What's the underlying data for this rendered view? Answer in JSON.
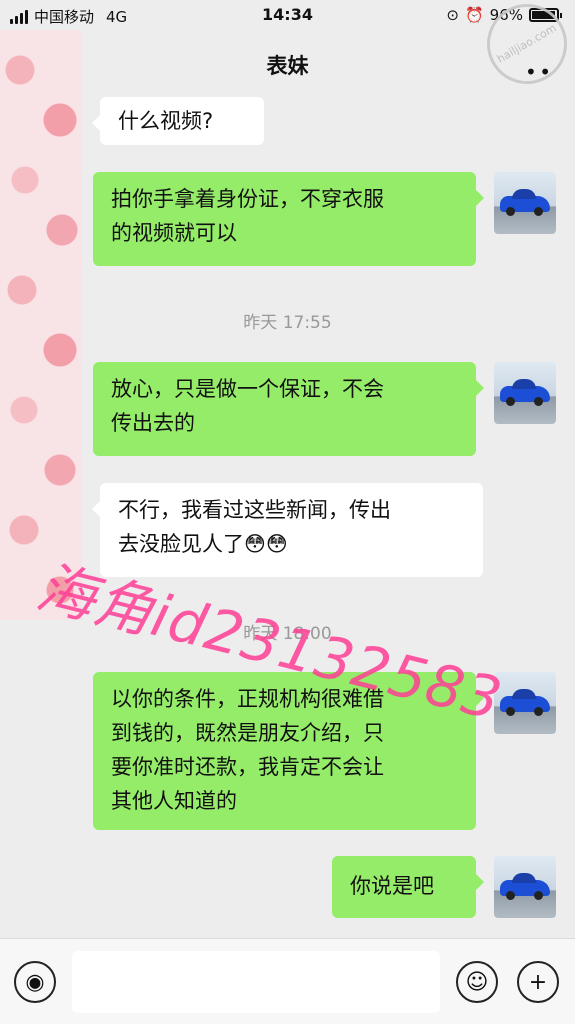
{
  "status_bar": {
    "carrier": "中国移动",
    "network": "4G",
    "time": "14:34",
    "battery": "96%",
    "battery_level": 0.96
  },
  "nav": {
    "title": "表妹",
    "more_icon": "more-dots-icon"
  },
  "stamp_text": "hailjiao.com",
  "messages": [
    {
      "side": "in",
      "text": "什么视频?"
    },
    {
      "side": "out",
      "lines": [
        "拍你手拿着身份证，不穿衣服",
        "的视频就可以"
      ]
    },
    {
      "type": "time",
      "text": "昨天 17:55"
    },
    {
      "side": "out",
      "lines": [
        "放心，只是做一个保证，不会",
        "传出去的"
      ]
    },
    {
      "side": "in",
      "lines": [
        "不行，我看过这些新闻，传出",
        "去没脸见人了😳😳"
      ]
    },
    {
      "type": "time",
      "text": "昨天 18:00"
    },
    {
      "side": "out",
      "lines": [
        "以你的条件，正规机构很难借",
        "到钱的，既然是朋友介绍，只",
        "要你准时还款，我肯定不会让",
        "其他人知道的"
      ]
    },
    {
      "side": "out",
      "text": "你说是吧"
    }
  ],
  "watermark": "海角id23132583",
  "input_bar": {
    "voice_icon": "voice-icon",
    "emoji_icon": "emoji-icon",
    "plus_icon": "plus-icon",
    "value": ""
  },
  "colors": {
    "outgoing_bubble": "#95ec69",
    "incoming_bubble": "#ffffff",
    "background": "#ededed",
    "watermark": "#ff3f96"
  }
}
